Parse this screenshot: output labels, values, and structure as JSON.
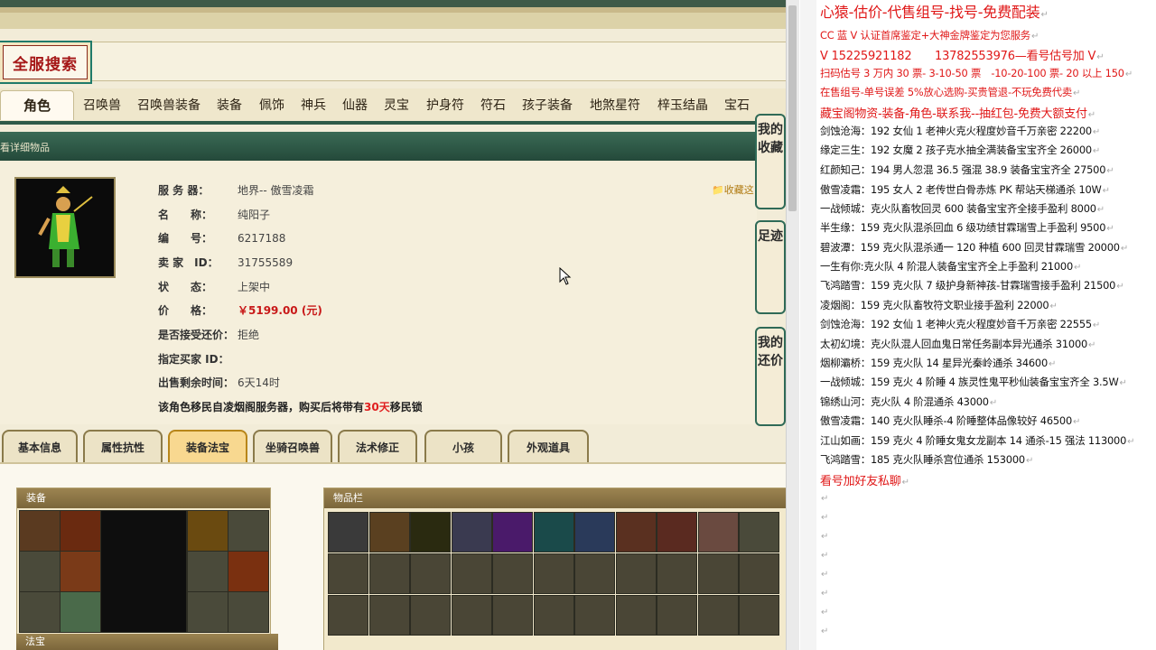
{
  "search_badge": "全服搜索",
  "category_tabs": [
    "角色",
    "召唤兽",
    "召唤兽装备",
    "装备",
    "佩饰",
    "神兵",
    "仙器",
    "灵宝",
    "护身符",
    "符石",
    "孩子装备",
    "地煞星符",
    "梓玉结晶",
    "宝石"
  ],
  "detail_header": "看详细物品",
  "info": {
    "server_label": "服 务 器：",
    "server_value": "地界-- 傲雪凌霜",
    "name_label": "名　　称：",
    "name_value": "纯阳子",
    "id_label": "编　　号：",
    "id_value": "6217188",
    "seller_label": "卖 家　ID：",
    "seller_value": "31755589",
    "status_label": "状　　态：",
    "status_value": "上架中",
    "price_label": "价　　格：",
    "price_value": "￥5199.00 (元)",
    "counter_label": "是否接受还价：",
    "counter_value": "拒绝",
    "buyer_label": "指定买家 ID：",
    "buyer_value": "",
    "remain_label": "出售剩余时间：",
    "remain_value": "6天14时",
    "note_pre": "该角色移民自凌烟阁服务器，购买后将带有",
    "note_days": "30天",
    "note_post": "移民锁"
  },
  "fav_label": "收藏这",
  "side_buttons": [
    "我的收藏",
    "足迹",
    "我的还价"
  ],
  "sub_tabs": [
    "基本信息",
    "属性抗性",
    "装备法宝",
    "坐骑召唤兽",
    "法术修正",
    "小孩",
    "外观道具"
  ],
  "equip_header": "装备",
  "items_header": "物品栏",
  "fabao_header": "法宝",
  "doc_lines": [
    {
      "text": "心猿-估价-代售组号-找号-免费配装",
      "style": "red big"
    },
    {
      "text": "CC 蓝 V 认证首席鉴定+大神金牌鉴定为您服务",
      "style": "red"
    },
    {
      "text": "V 15225921182　　13782553976—看号估号加 V",
      "style": "red big2"
    },
    {
      "text": "扫码估号 3 万内 30 票- 3-10-50 票　-10-20-100 票- 20 以上 150",
      "style": "red"
    },
    {
      "text": "在售组号-单号误差 5%放心选购-买贵管退-不玩免费代卖",
      "style": "red"
    },
    {
      "text": "藏宝阁物资-装备-角色-联系我--抽红包-免费大额支付",
      "style": "red big2"
    },
    {
      "text": "剑蚀沧海：192 女仙 1 老神火克火程度妙音千万亲密 22200",
      "style": ""
    },
    {
      "text": "缘定三生：192 女魔 2 孩子克水抽全满装备宝宝齐全 26000",
      "style": ""
    },
    {
      "text": "红颜知己：194 男人忽混 36.5 强混 38.9 装备宝宝齐全 27500",
      "style": ""
    },
    {
      "text": "傲雪凌霜：195 女人 2 老传世白骨赤炼 PK 帮站天梯通杀 10W",
      "style": ""
    },
    {
      "text": "一战倾城：克火队畜牧回灵 600 装备宝宝齐全接手盈利 8000",
      "style": ""
    },
    {
      "text": "半生缘：159 克火队混杀回血 6 级功绩甘霖瑞雪上手盈利 9500",
      "style": ""
    },
    {
      "text": "碧波潭：159 克火队混杀通一 120 种植 600 回灵甘霖瑞雪 20000",
      "style": ""
    },
    {
      "text": "一生有你:克火队 4 阶混人装备宝宝齐全上手盈利 21000",
      "style": ""
    },
    {
      "text": "飞鸿踏雪：159 克火队 7 级护身新神孩-甘霖瑞雪接手盈利 21500",
      "style": ""
    },
    {
      "text": "凌烟阁：159 克火队畜牧符文职业接手盈利 22000",
      "style": ""
    },
    {
      "text": "剑蚀沧海：192 女仙 1 老神火克火程度妙音千万亲密 22555",
      "style": ""
    },
    {
      "text": "太初幻境：克火队混人回血鬼日常任务副本异光通杀 31000",
      "style": ""
    },
    {
      "text": "烟柳灞桥：159 克火队 14 星异光秦岭通杀 34600",
      "style": ""
    },
    {
      "text": "一战倾城：159 克火 4 阶睡 4 族灵性鬼平秒仙装备宝宝齐全 3.5W",
      "style": ""
    },
    {
      "text": "锦绣山河：克火队 4 阶混通杀 43000",
      "style": ""
    },
    {
      "text": "傲雪凌霜：140 克火队睡杀-4 阶睡整体品像较好 46500",
      "style": ""
    },
    {
      "text": "江山如画：159 克火 4 阶睡女鬼女龙副本 14 通杀-15 强法 113000",
      "style": ""
    },
    {
      "text": "飞鸿踏雪：185 克火队睡杀宫位通杀 153000",
      "style": ""
    },
    {
      "text": "看号加好友私聊",
      "style": "red big2"
    }
  ]
}
